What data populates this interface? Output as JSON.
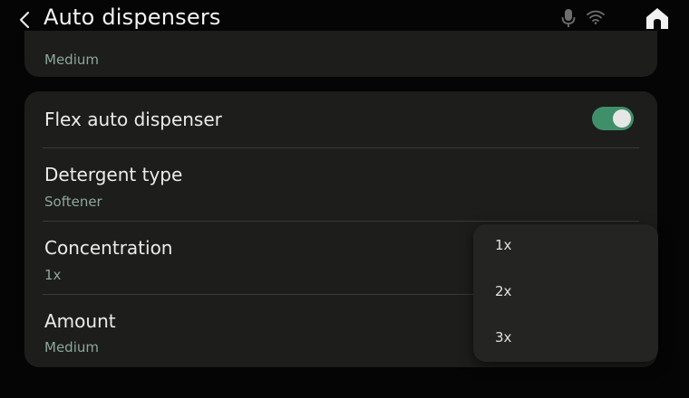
{
  "header": {
    "title": "Auto dispensers",
    "back_icon": "chevron-left-icon",
    "mic_icon": "microphone-icon",
    "wifi_icon": "wifi-icon",
    "home_icon": "home-icon"
  },
  "previous_card": {
    "partial_value": "Medium"
  },
  "settings": {
    "flex_auto_dispenser": {
      "label": "Flex auto dispenser",
      "enabled": true
    },
    "detergent_type": {
      "label": "Detergent type",
      "value": "Softener"
    },
    "concentration": {
      "label": "Concentration",
      "value": "1x"
    },
    "amount": {
      "label": "Amount",
      "value": "Medium"
    }
  },
  "dropdown": {
    "options": [
      "1x",
      "2x",
      "3x"
    ]
  },
  "colors": {
    "accent": "#3f8f6b",
    "value_text": "#8ca89c",
    "card_bg": "#1d1d1b"
  }
}
